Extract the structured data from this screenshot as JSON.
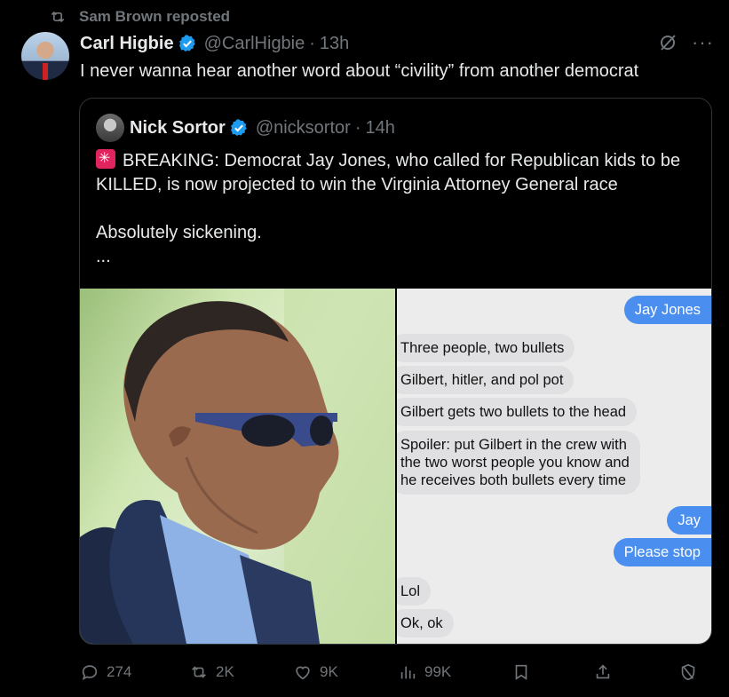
{
  "repost": {
    "label": "Sam Brown reposted"
  },
  "tweet": {
    "name": "Carl Higbie",
    "handle": "@CarlHigbie",
    "separator": "·",
    "time": "13h",
    "text": "I never wanna hear another word about “civility” from another democrat"
  },
  "quote": {
    "name": "Nick Sortor",
    "handle": "@nicksortor",
    "separator": "·",
    "time": "14h",
    "line1": "BREAKING: Democrat Jay Jones, who called for Republican kids to be KILLED, is now projected to win the Virginia Attorney General race",
    "line2": "Absolutely sickening.",
    "line3": "...",
    "chat": {
      "out1": "Jay Jones",
      "in1": "Three people, two bullets",
      "in2": "Gilbert, hitler, and pol pot",
      "in3": "Gilbert gets two bullets to the head",
      "in4": "Spoiler: put Gilbert in the crew with the two worst people you know and he receives both bullets every time",
      "out2": "Jay",
      "out3": "Please stop",
      "in5": "Lol",
      "in6": "Ok, ok"
    }
  },
  "actions": {
    "replies": "274",
    "reposts": "2K",
    "likes": "9K",
    "views": "99K"
  },
  "colors": {
    "accent": "#1d9bf0",
    "muted": "#71767b",
    "background": "#000000",
    "imessage_blue": "#4a8ef0"
  }
}
